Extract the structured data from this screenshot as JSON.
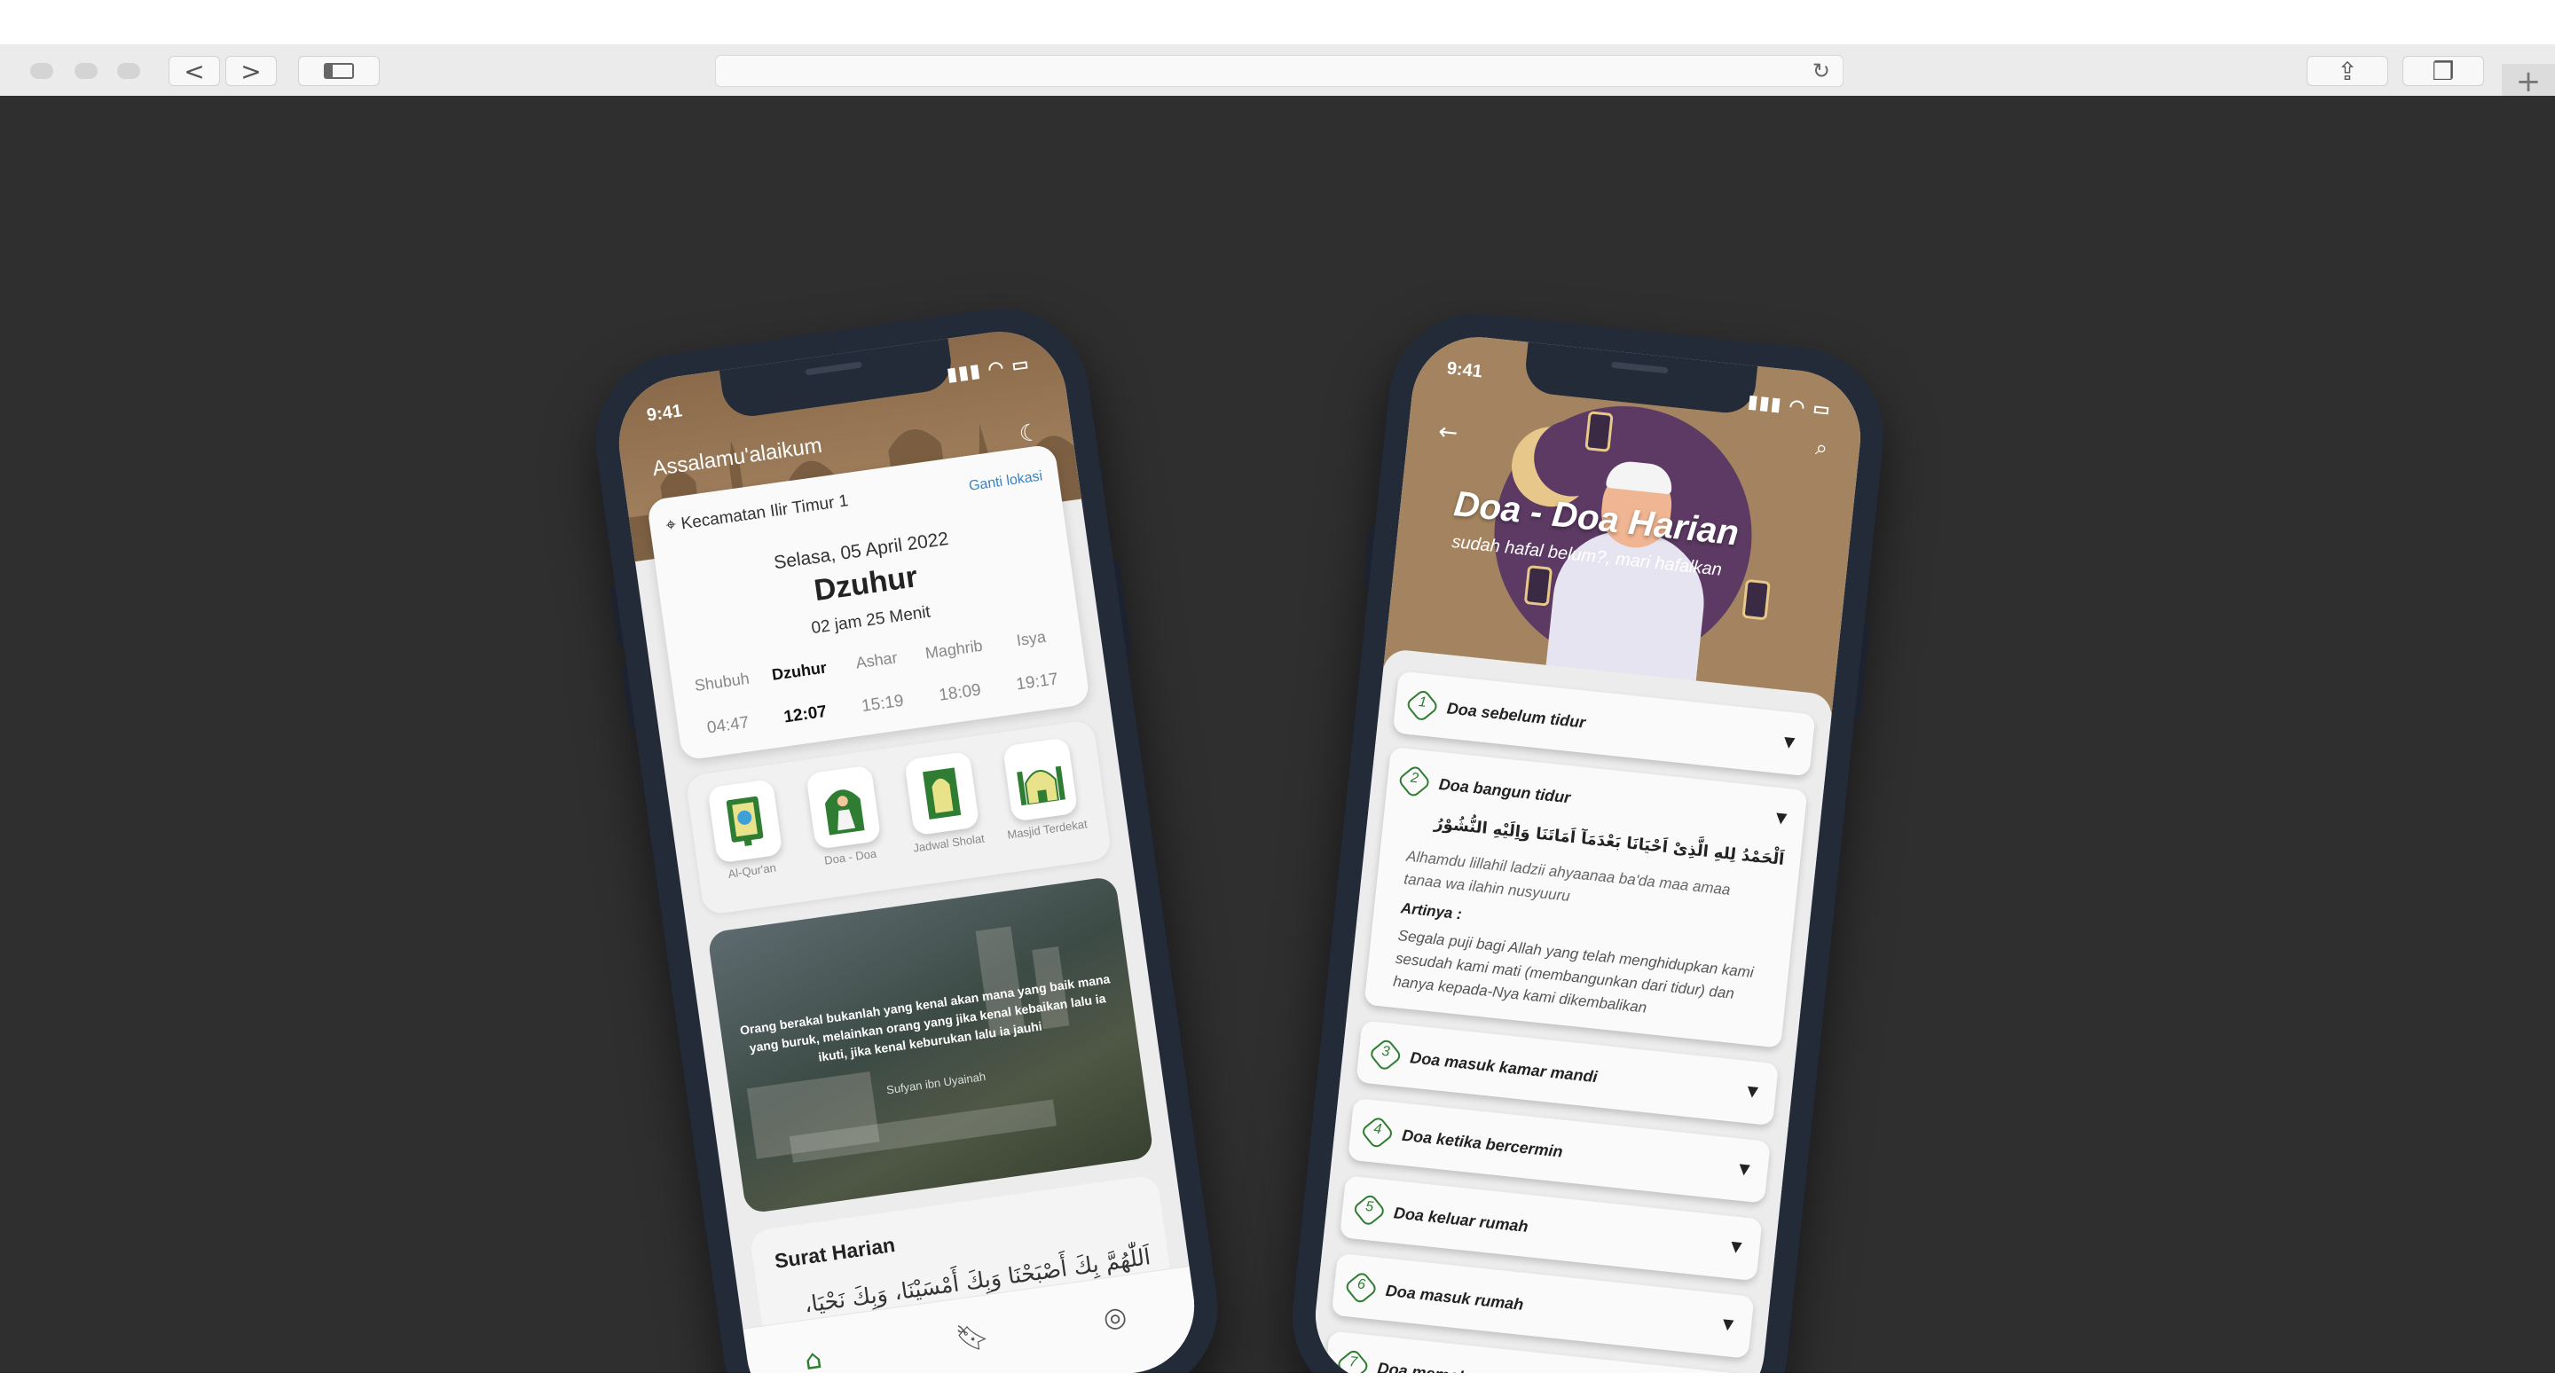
{
  "browser": {
    "back_glyph": "<",
    "forward_glyph": ">",
    "reload_glyph": "↻",
    "share_glyph": "⇪",
    "tabs_glyph": "❐",
    "new_tab_glyph": "+"
  },
  "colors": {
    "background": "#2f2f2f",
    "phone_frame": "#232a38",
    "brand_brown": "#a48460",
    "accent_green": "#2e7d32",
    "link_blue": "#3b82c4"
  },
  "home": {
    "status_time": "9:41",
    "greeting": "Assalamu'alaikum",
    "location": "Kecamatan Ilir Timur 1",
    "change_location": "Ganti lokasi",
    "date": "Selasa, 05 April 2022",
    "next_prayer": "Dzuhur",
    "remaining": "02 jam 25 Menit",
    "prayers": [
      {
        "name": "Shubuh",
        "time": "04:47"
      },
      {
        "name": "Dzuhur",
        "time": "12:07"
      },
      {
        "name": "Ashar",
        "time": "15:19"
      },
      {
        "name": "Maghrib",
        "time": "18:09"
      },
      {
        "name": "Isya",
        "time": "19:17"
      }
    ],
    "menu": [
      {
        "label": "Al-Qur'an",
        "icon": "quran-icon"
      },
      {
        "label": "Doa - Doa",
        "icon": "prayer-icon"
      },
      {
        "label": "Jadwal Sholat",
        "icon": "prayer-mat-icon"
      },
      {
        "label": "Masjid Terdekat",
        "icon": "mosque-icon"
      }
    ],
    "quote": "Orang berakal bukanlah yang kenal akan mana yang baik mana yang buruk, melainkan orang yang jika kenal kebaikan lalu ia ikuti, jika kenal keburukan lalu ia jauhi",
    "quote_author": "Sufyan ibn Uyainah",
    "surat_title": "Surat Harian",
    "surat_arabic": "اَللّٰهُمَّ بِكَ أَصْبَحْنَا وَبِكَ أَمْسَيْنَا، وَبِكَ نَحْيَا، وَبِكَ نَمُوْتُ، وَإِلَيْكَ النُّشُوْرُ",
    "tabs": [
      "home-icon",
      "bookmark-icon",
      "profile-icon"
    ]
  },
  "doa": {
    "status_time": "9:41",
    "title": "Doa - Doa Harian",
    "subtitle": "sudah hafal belum?, mari hafalkan",
    "items": [
      {
        "num": "1",
        "title": "Doa sebelum tidur"
      },
      {
        "num": "2",
        "title": "Doa bangun tidur"
      },
      {
        "num": "3",
        "title": "Doa masuk kamar mandi"
      },
      {
        "num": "4",
        "title": "Doa ketika bercermin"
      },
      {
        "num": "5",
        "title": "Doa keluar rumah"
      },
      {
        "num": "6",
        "title": "Doa masuk rumah"
      },
      {
        "num": "7",
        "title": "Doa memohon ilmu yang bermanfaat"
      }
    ],
    "expanded": {
      "arabic": "اَلْحَمْدُ لِلهِ الَّذِىْ اَحْيَانَا بَعْدَمَآ اَمَاتَنَا وَاِلَيْهِ النُّشُوْرُ",
      "latin": "Alhamdu lillahil ladzii ahyaanaa ba'da maa amaa tanaa wa ilahin nusyuuru",
      "artinya_label": "Artinya :",
      "artinya": "Segala puji bagi Allah yang telah menghidupkan kami sesudah kami mati (membangunkan dari tidur) dan hanya kepada-Nya kami dikembalikan"
    }
  }
}
